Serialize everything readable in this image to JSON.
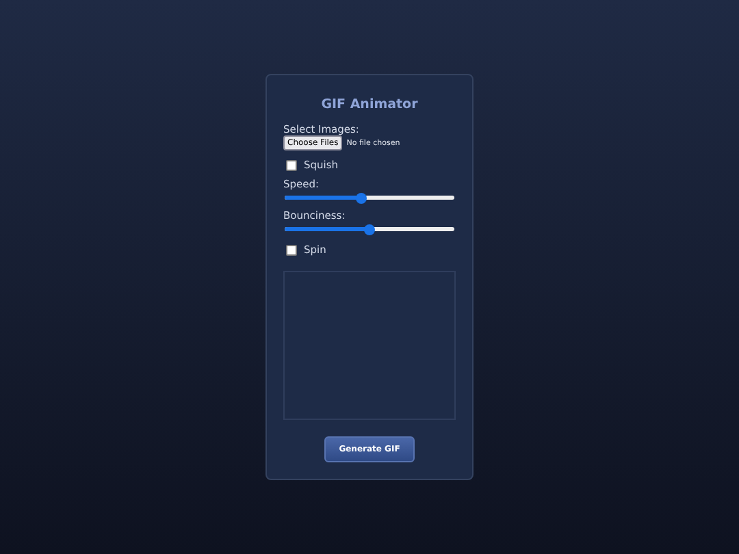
{
  "title": "GIF Animator",
  "controls": [
    {
      "kind": "file",
      "label": "Select Images:",
      "button": "Choose Files",
      "status": "No file chosen"
    },
    {
      "kind": "checkbox",
      "label": "Squish",
      "checked": false
    },
    {
      "kind": "slider",
      "label": "Speed:",
      "level": 0.45
    },
    {
      "kind": "slider",
      "label": "Bounciness:",
      "level": 0.5
    },
    {
      "kind": "checkbox",
      "label": "Spin",
      "checked": false
    }
  ],
  "button": "Generate GIF"
}
